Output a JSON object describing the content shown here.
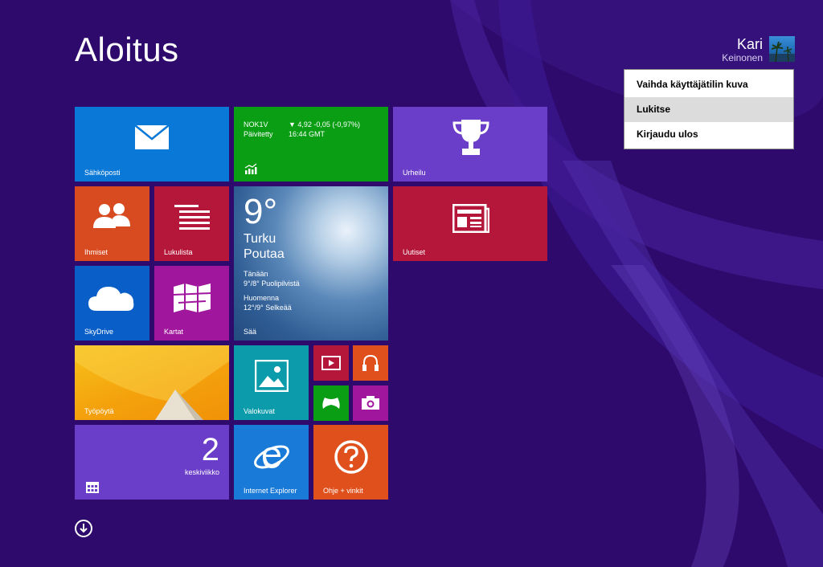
{
  "start": {
    "title": "Aloitus"
  },
  "user": {
    "first_name": "Kari",
    "last_name": "Keinonen"
  },
  "account_menu": {
    "items": [
      {
        "label": "Vaihda käyttäjätilin kuva"
      },
      {
        "label": "Lukitse"
      },
      {
        "label": "Kirjaudu ulos"
      }
    ]
  },
  "tiles": {
    "mail": {
      "label": "Sähköposti",
      "color": "#0a78d7"
    },
    "finance": {
      "symbol": "NOK1V",
      "change": "▼ 4,92  -0,05 (-0,97%)",
      "updated_label": "Päivitetty",
      "updated_time": "16:44 GMT",
      "color": "#0a9e14"
    },
    "sports": {
      "label": "Urheilu",
      "color": "#6a3ec8"
    },
    "people": {
      "label": "Ihmiset",
      "color": "#d84a1f"
    },
    "readinglist": {
      "label": "Lukulista",
      "color": "#b4173a"
    },
    "weather": {
      "temperature": "9°",
      "city": "Turku",
      "condition": "Poutaa",
      "today_label": "Tänään",
      "today_forecast": "9°/8° Puolipilvistä",
      "tomorrow_label": "Huomenna",
      "tomorrow_forecast": "12°/9° Selkeää",
      "label": "Sää"
    },
    "news": {
      "label": "Uutiset",
      "color": "#b4173a"
    },
    "skydrive": {
      "label": "SkyDrive",
      "color": "#0a5ec8"
    },
    "maps": {
      "label": "Kartat",
      "color": "#a0169c"
    },
    "desktop": {
      "label": "Työpöytä"
    },
    "photos": {
      "label": "Valokuvat",
      "color": "#0b9bab"
    },
    "calendar": {
      "day": "2",
      "weekday": "keskiviikko",
      "color": "#6a3ec8"
    },
    "ie": {
      "label": "Internet Explorer",
      "color": "#1a7ad8"
    },
    "help": {
      "label": "Ohje + vinkit",
      "color": "#e0501c"
    }
  },
  "icons": [
    "mail-icon",
    "stocks-icon",
    "trophy-icon",
    "people-icon",
    "reading-list-icon",
    "news-icon",
    "cloud-icon",
    "map-icon",
    "photo-icon",
    "video-icon",
    "music-icon",
    "games-icon",
    "camera-icon",
    "calendar-icon",
    "ie-icon",
    "help-icon",
    "all-apps-icon"
  ]
}
